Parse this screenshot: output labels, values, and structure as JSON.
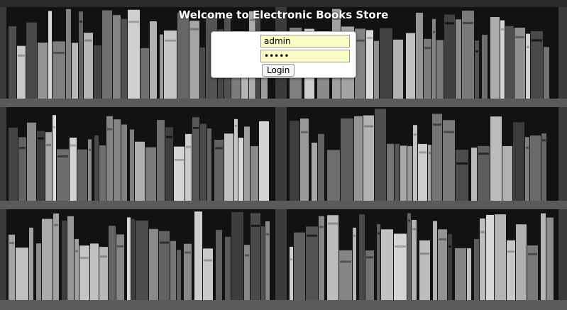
{
  "page": {
    "title": "Welcome to Electronic Books Store"
  },
  "login": {
    "username_value": "admin",
    "password_value": "•••••",
    "submit_label": "Login"
  }
}
